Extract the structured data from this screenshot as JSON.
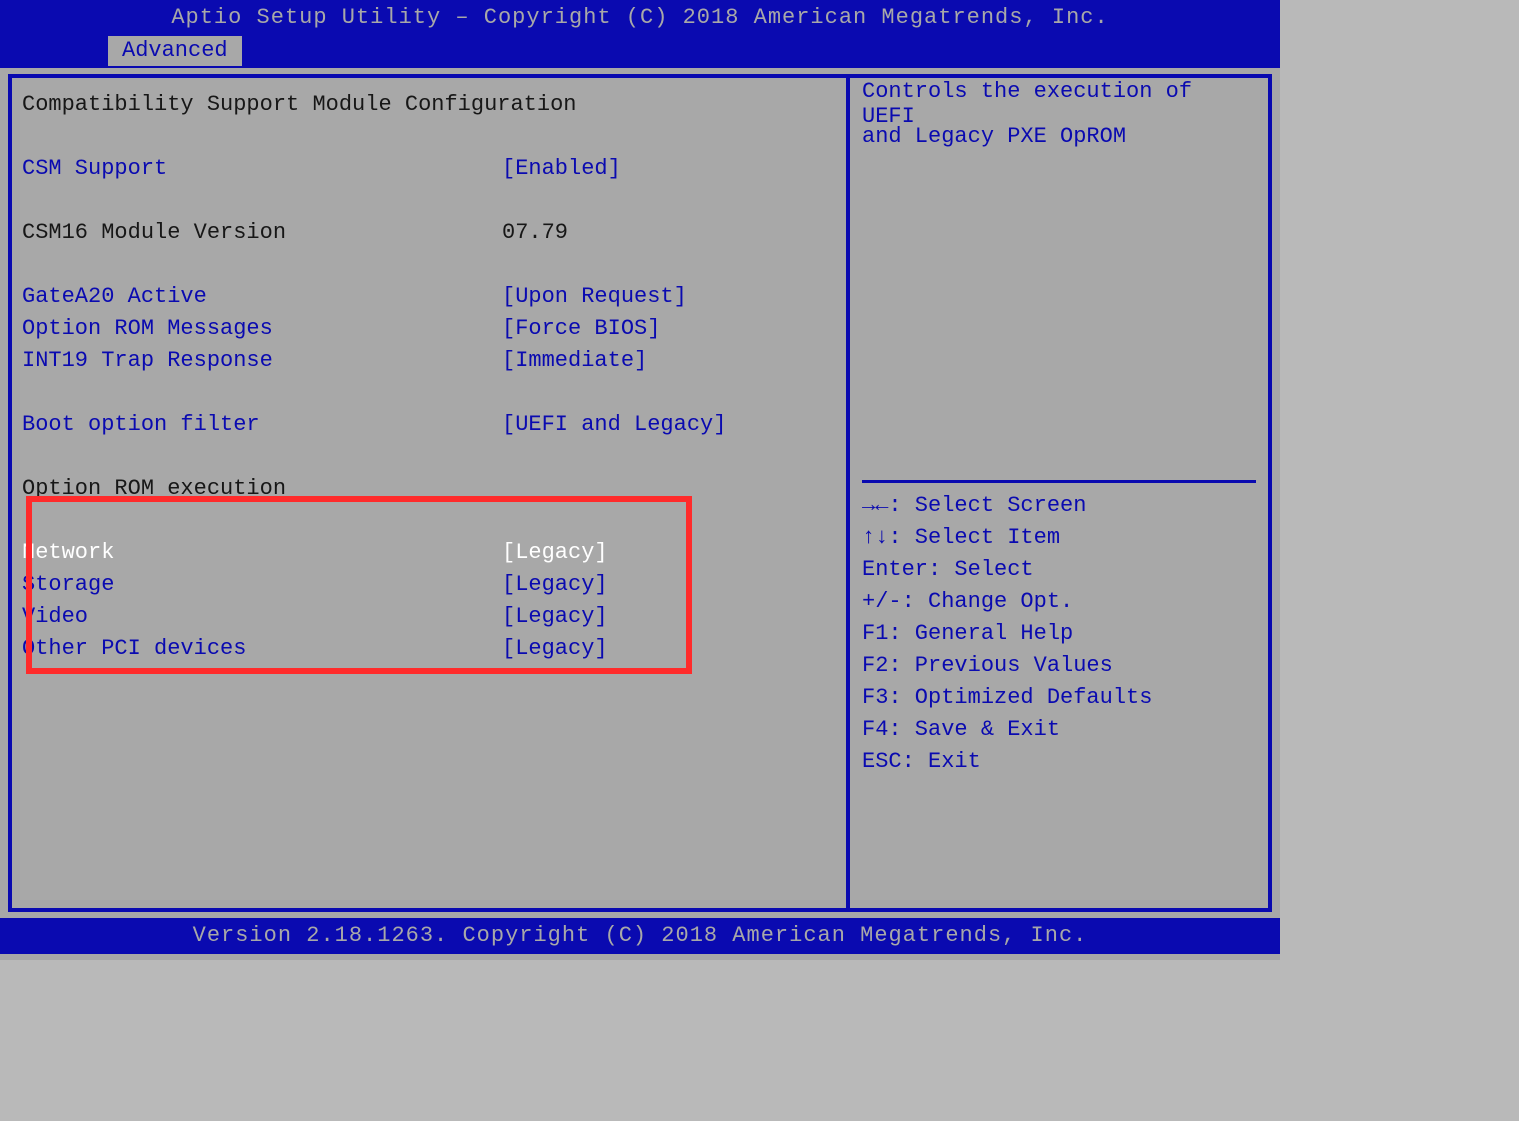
{
  "header": {
    "title": "Aptio Setup Utility – Copyright (C) 2018 American Megatrends, Inc.",
    "tab": "Advanced"
  },
  "main": {
    "section_title": "Compatibility Support Module Configuration",
    "csm_support": {
      "label": "CSM Support",
      "value": "[Enabled]"
    },
    "csm16_version": {
      "label": "CSM16 Module Version",
      "value": "07.79"
    },
    "gatea20": {
      "label": "GateA20 Active",
      "value": "[Upon Request]"
    },
    "oprom_msgs": {
      "label": "Option ROM Messages",
      "value": "[Force BIOS]"
    },
    "int19": {
      "label": "INT19 Trap Response",
      "value": "[Immediate]"
    },
    "boot_filter": {
      "label": "Boot option filter",
      "value": "[UEFI and Legacy]"
    },
    "oprom_exec_title": "Option ROM execution",
    "network": {
      "label": "Network",
      "value": "[Legacy]"
    },
    "storage": {
      "label": "Storage",
      "value": "[Legacy]"
    },
    "video": {
      "label": "Video",
      "value": "[Legacy]"
    },
    "other_pci": {
      "label": "Other PCI devices",
      "value": "[Legacy]"
    }
  },
  "help": {
    "description_line1": "Controls the execution of UEFI",
    "description_line2": "and Legacy PXE OpROM",
    "keys": {
      "select_screen": "→←: Select Screen",
      "select_item": "↑↓: Select Item",
      "enter": "Enter: Select",
      "change": "+/-: Change Opt.",
      "f1": "F1: General Help",
      "f2": "F2: Previous Values",
      "f3": "F3: Optimized Defaults",
      "f4": "F4: Save & Exit",
      "esc": "ESC: Exit"
    }
  },
  "footer": {
    "text": "Version 2.18.1263. Copyright (C) 2018 American Megatrends, Inc."
  }
}
